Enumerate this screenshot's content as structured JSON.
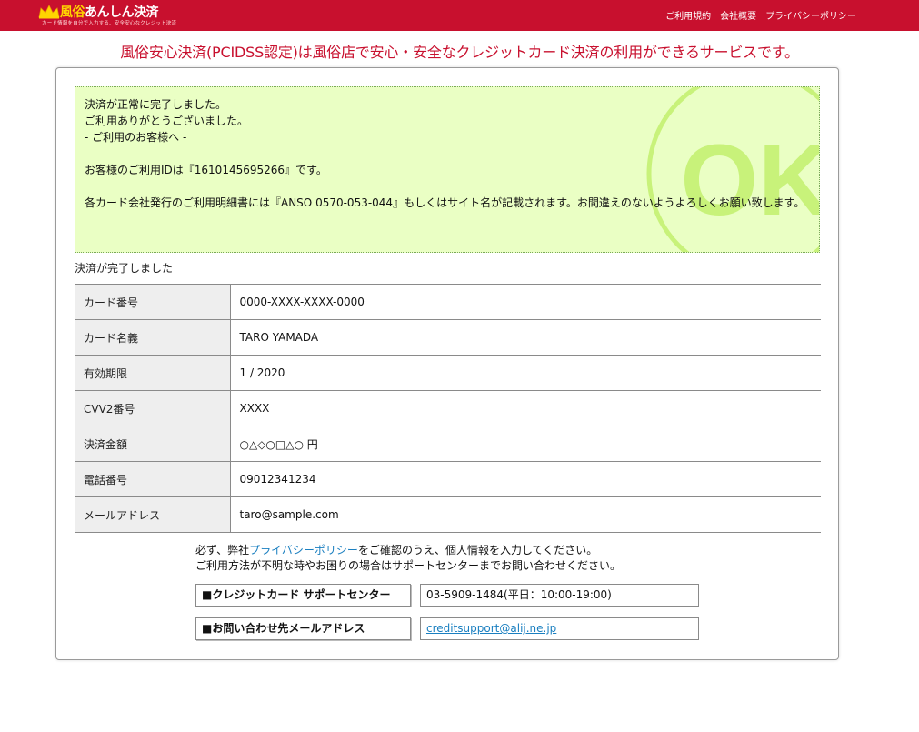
{
  "header": {
    "logo_prefix": "風俗",
    "logo_main": "あんしん決済",
    "logo_sub": "カード情報を自分で入力する、安全安心なクレジット決済",
    "nav": [
      "ご利用規約",
      "会社概要",
      "プライバシーポリシー"
    ]
  },
  "headline": "風俗安心決済(PCIDSS認定)は風俗店で安心・安全なクレジットカード決済の利用ができるサービスです。",
  "result_box": {
    "badge": "OK",
    "line1": "決済が正常に完了しました。",
    "line2": "ご利用ありがとうございました。",
    "line3": "- ご利用のお客様へ -",
    "line4": "お客様のご利用IDは『1610145695266』です。",
    "line5": "各カード会社発行のご利用明細書には『ANSO 0570-053-044』もしくはサイト名が記載されます。お間違えのないようよろしくお願い致します。"
  },
  "complete_label": "決済が完了しました",
  "details": [
    {
      "label": "カード番号",
      "value": "0000-XXXX-XXXX-0000"
    },
    {
      "label": "カード名義",
      "value": "TARO YAMADA"
    },
    {
      "label": "有効期限",
      "value": "1 / 2020"
    },
    {
      "label": "CVV2番号",
      "value": "XXXX"
    },
    {
      "label": "決済金額",
      "value": "○△◇○□△○ 円"
    },
    {
      "label": "電話番号",
      "value": "09012341234"
    },
    {
      "label": "メールアドレス",
      "value": "taro@sample.com"
    }
  ],
  "notice": {
    "prefix": "必ず、弊社",
    "link": "プライバシーポリシー",
    "suffix": "をご確認のうえ、個人情報を入力してください。",
    "line2": "ご利用方法が不明な時やお困りの場合はサポートセンターまでお問い合わせください。"
  },
  "support": {
    "phone_label": "■クレジットカード サポートセンター",
    "phone_value": "03-5909-1484(平日：10:00-19:00)",
    "email_label": "■お問い合わせ先メールアドレス",
    "email_value": "creditsupport@alij.ne.jp"
  },
  "colors": {
    "header_bg": "#c8102e",
    "headline": "#c8102e",
    "ok_box_bg": "#eaffc4",
    "ok_mark": "#c8f27a",
    "link": "#1a7fc0"
  },
  "icons": [
    "crown-icon",
    "ok-badge-icon"
  ]
}
